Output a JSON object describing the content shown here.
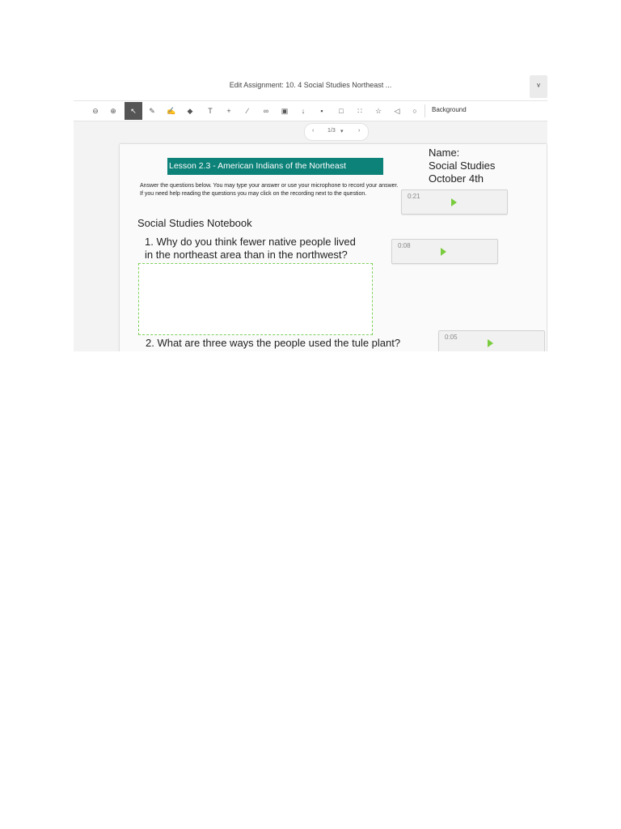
{
  "window": {
    "title": "Edit Assignment: 10. 4 Social Studies Northeast ...",
    "corner_icon": "ᵛ"
  },
  "toolbar": {
    "tools": [
      {
        "name": "zoom-out-icon",
        "glyph": "⊖"
      },
      {
        "name": "zoom-in-icon",
        "glyph": "⊕"
      },
      {
        "name": "select-pointer-icon",
        "glyph": "↖"
      },
      {
        "name": "pen-icon",
        "glyph": "✎"
      },
      {
        "name": "highlighter-icon",
        "glyph": "✍"
      },
      {
        "name": "eraser-icon",
        "glyph": "◆"
      },
      {
        "name": "text-icon",
        "glyph": "T"
      },
      {
        "name": "add-icon",
        "glyph": "+"
      },
      {
        "name": "line-icon",
        "glyph": "∕"
      },
      {
        "name": "link-icon",
        "glyph": "∞"
      },
      {
        "name": "camera-icon",
        "glyph": "▣"
      },
      {
        "name": "microphone-icon",
        "glyph": "↓"
      },
      {
        "name": "shapes-icon",
        "glyph": "▪"
      },
      {
        "name": "square-select-icon",
        "glyph": "□"
      },
      {
        "name": "grid-icon",
        "glyph": "∷"
      },
      {
        "name": "star-icon",
        "glyph": "☆"
      },
      {
        "name": "speaker-icon",
        "glyph": "◁"
      },
      {
        "name": "drop-icon",
        "glyph": "○"
      }
    ],
    "background_label": "Background"
  },
  "pager": {
    "prev": "‹",
    "label": "1/3",
    "caret": "▾",
    "next": "›"
  },
  "worksheet": {
    "banner": "Lesson 2.3 - American Indians of the Northeast",
    "instructions": "Answer the questions below. You may type your answer or use your microphone to record your answer. If you need help reading the questions you may click on the recording next to the question.",
    "name_label": "Name:",
    "subject": "Social Studies",
    "date": "October 4th",
    "notebook_heading": "Social Studies Notebook",
    "question1_line1": "1. Why do you think fewer native people lived",
    "question1_line2": "in the northeast area than in the northwest?",
    "question2": "2. What are three ways the people used the tule plant?",
    "recordings": [
      {
        "time": "0:21"
      },
      {
        "time": "0:08"
      },
      {
        "time": "0:05"
      }
    ]
  },
  "colors": {
    "banner": "#0d8279",
    "play_button": "#7acc3f",
    "answer_border": "#7fd15b"
  }
}
